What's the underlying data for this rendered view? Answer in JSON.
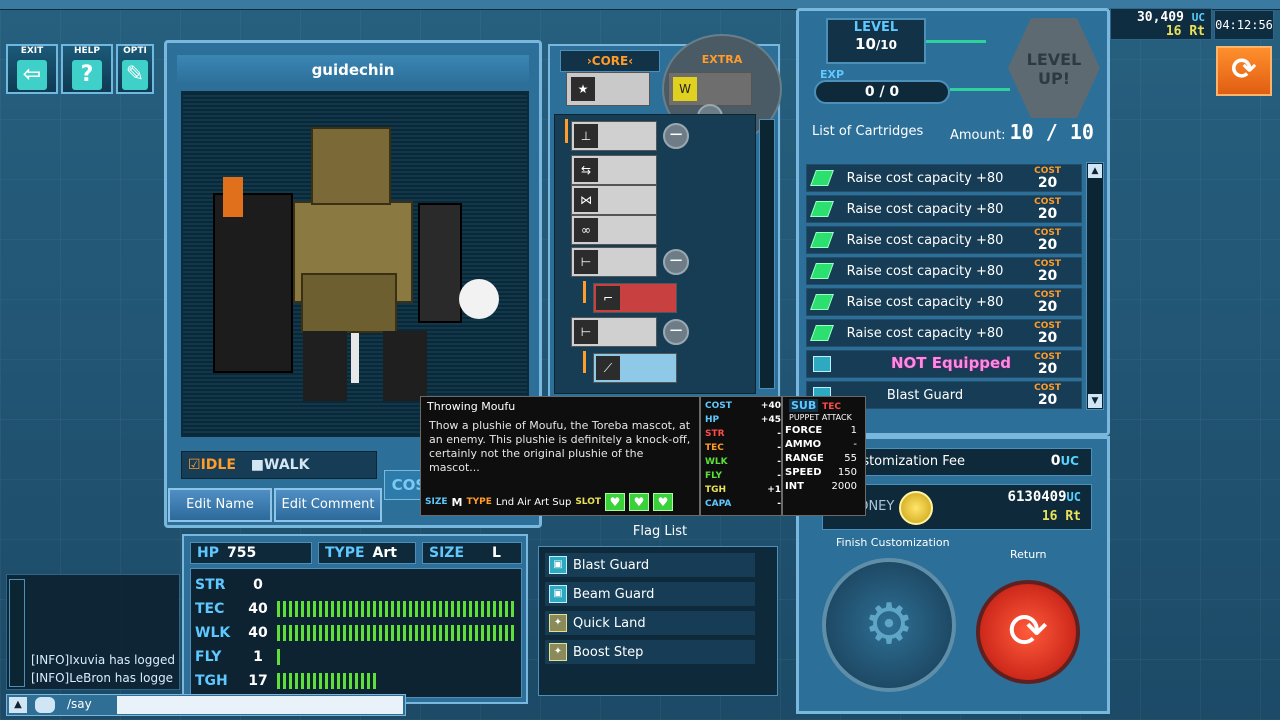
{
  "top_buttons": [
    {
      "label": "EXIT",
      "icon": "exit-icon",
      "glyph": "⇦"
    },
    {
      "label": "HELP",
      "icon": "help-icon",
      "glyph": "?"
    },
    {
      "label": "OPTI",
      "icon": "wrench-icon",
      "glyph": "✎"
    }
  ],
  "status": {
    "uc": "30,409",
    "uc_unit": "UC",
    "rt": "16 Rt",
    "clock": "04:12:56"
  },
  "puppet": {
    "name": "guidechin",
    "anim_idle": "IDLE",
    "anim_walk": "WALK",
    "cost_tab": "COST",
    "edit_name": "Edit Name",
    "edit_comment": "Edit Comment"
  },
  "stats": {
    "hp_key": "HP",
    "hp": "755",
    "type_key": "TYPE",
    "type": "Art",
    "size_key": "SIZE",
    "size": "L",
    "rows": [
      {
        "key": "STR",
        "value": "0",
        "fill": 0
      },
      {
        "key": "TEC",
        "value": "40",
        "fill": 1.0
      },
      {
        "key": "WLK",
        "value": "40",
        "fill": 1.0
      },
      {
        "key": "FLY",
        "value": "1",
        "fill": 0.025
      },
      {
        "key": "TGH",
        "value": "17",
        "fill": 0.425
      }
    ]
  },
  "flags": {
    "title": "Flag List",
    "items": [
      {
        "label": "Blast Guard",
        "icon": "shield-icon"
      },
      {
        "label": "Beam Guard",
        "icon": "shield-icon"
      },
      {
        "label": "Quick Land",
        "icon": "gear-icon"
      },
      {
        "label": "Boost Step",
        "icon": "gear-icon"
      }
    ]
  },
  "core": {
    "core_label": "CORE",
    "extra_label": "EXTRA"
  },
  "level": {
    "label": "LEVEL",
    "value": "10",
    "max": "/10",
    "exp_label": "EXP",
    "exp": "0 / 0",
    "levelup": "LEVEL UP!"
  },
  "cartridges": {
    "title": "List of Cartridges",
    "amount_label": "Amount:",
    "amount": "10 / 10",
    "items": [
      {
        "name": "Raise cost capacity +80",
        "cost_key": "COST",
        "cost": "20"
      },
      {
        "name": "Raise cost capacity +80",
        "cost_key": "COST",
        "cost": "20"
      },
      {
        "name": "Raise cost capacity +80",
        "cost_key": "COST",
        "cost": "20"
      },
      {
        "name": "Raise cost capacity +80",
        "cost_key": "COST",
        "cost": "20"
      },
      {
        "name": "Raise cost capacity +80",
        "cost_key": "COST",
        "cost": "20"
      },
      {
        "name": "Raise cost capacity +80",
        "cost_key": "COST",
        "cost": "20"
      },
      {
        "name": "",
        "cost_key": "COST",
        "cost": "20",
        "overlay": "NOT Equipped"
      },
      {
        "name": "Blast Guard",
        "cost_key": "COST",
        "cost": "20"
      }
    ]
  },
  "fee": {
    "label": "Customization Fee",
    "value": "0",
    "unit": "UC"
  },
  "money": {
    "label": "MONEY",
    "uc": "6130409",
    "uc_unit": "UC",
    "rt": "16 Rt"
  },
  "actions": {
    "finish": "Finish Customization",
    "return": "Return"
  },
  "tooltip": {
    "title": "Throwing Moufu",
    "desc": "Thow a plushie of Moufu, the Toreba mascot, at an enemy. This plushie is definitely a knock-off, certainly not the original plushie of the mascot...",
    "size_key": "SIZE",
    "size": "M",
    "type_key": "TYPE",
    "type": "Lnd Air Art Sup",
    "slot_key": "SLOT",
    "stats": [
      {
        "key": "COST",
        "value": "+40",
        "color": "#5ec8ff"
      },
      {
        "key": "HP",
        "value": "+45",
        "color": "#5ec8ff"
      },
      {
        "key": "STR",
        "value": "-",
        "color": "#ff4a4a"
      },
      {
        "key": "TEC",
        "value": "-",
        "color": "#ff9c2a"
      },
      {
        "key": "WLK",
        "value": "-",
        "color": "#5de13a"
      },
      {
        "key": "FLY",
        "value": "-",
        "color": "#5de13a"
      },
      {
        "key": "TGH",
        "value": "+1",
        "color": "#e9e25a"
      },
      {
        "key": "CAPA",
        "value": "-",
        "color": "#5ec8ff"
      }
    ],
    "sub": {
      "sub_key": "SUB",
      "tec_key": "TEC",
      "kind": "PUPPET ATTACK",
      "rows": [
        {
          "key": "FORCE",
          "value": "1"
        },
        {
          "key": "AMMO",
          "value": "-"
        },
        {
          "key": "RANGE",
          "value": "55"
        },
        {
          "key": "SPEED",
          "value": "150"
        },
        {
          "key": "INT",
          "value": "2000"
        }
      ]
    }
  },
  "chat": {
    "lines": [
      "[INFO]Ixuvia has logged",
      "[INFO]LeBron has logge"
    ],
    "say": "/say"
  }
}
